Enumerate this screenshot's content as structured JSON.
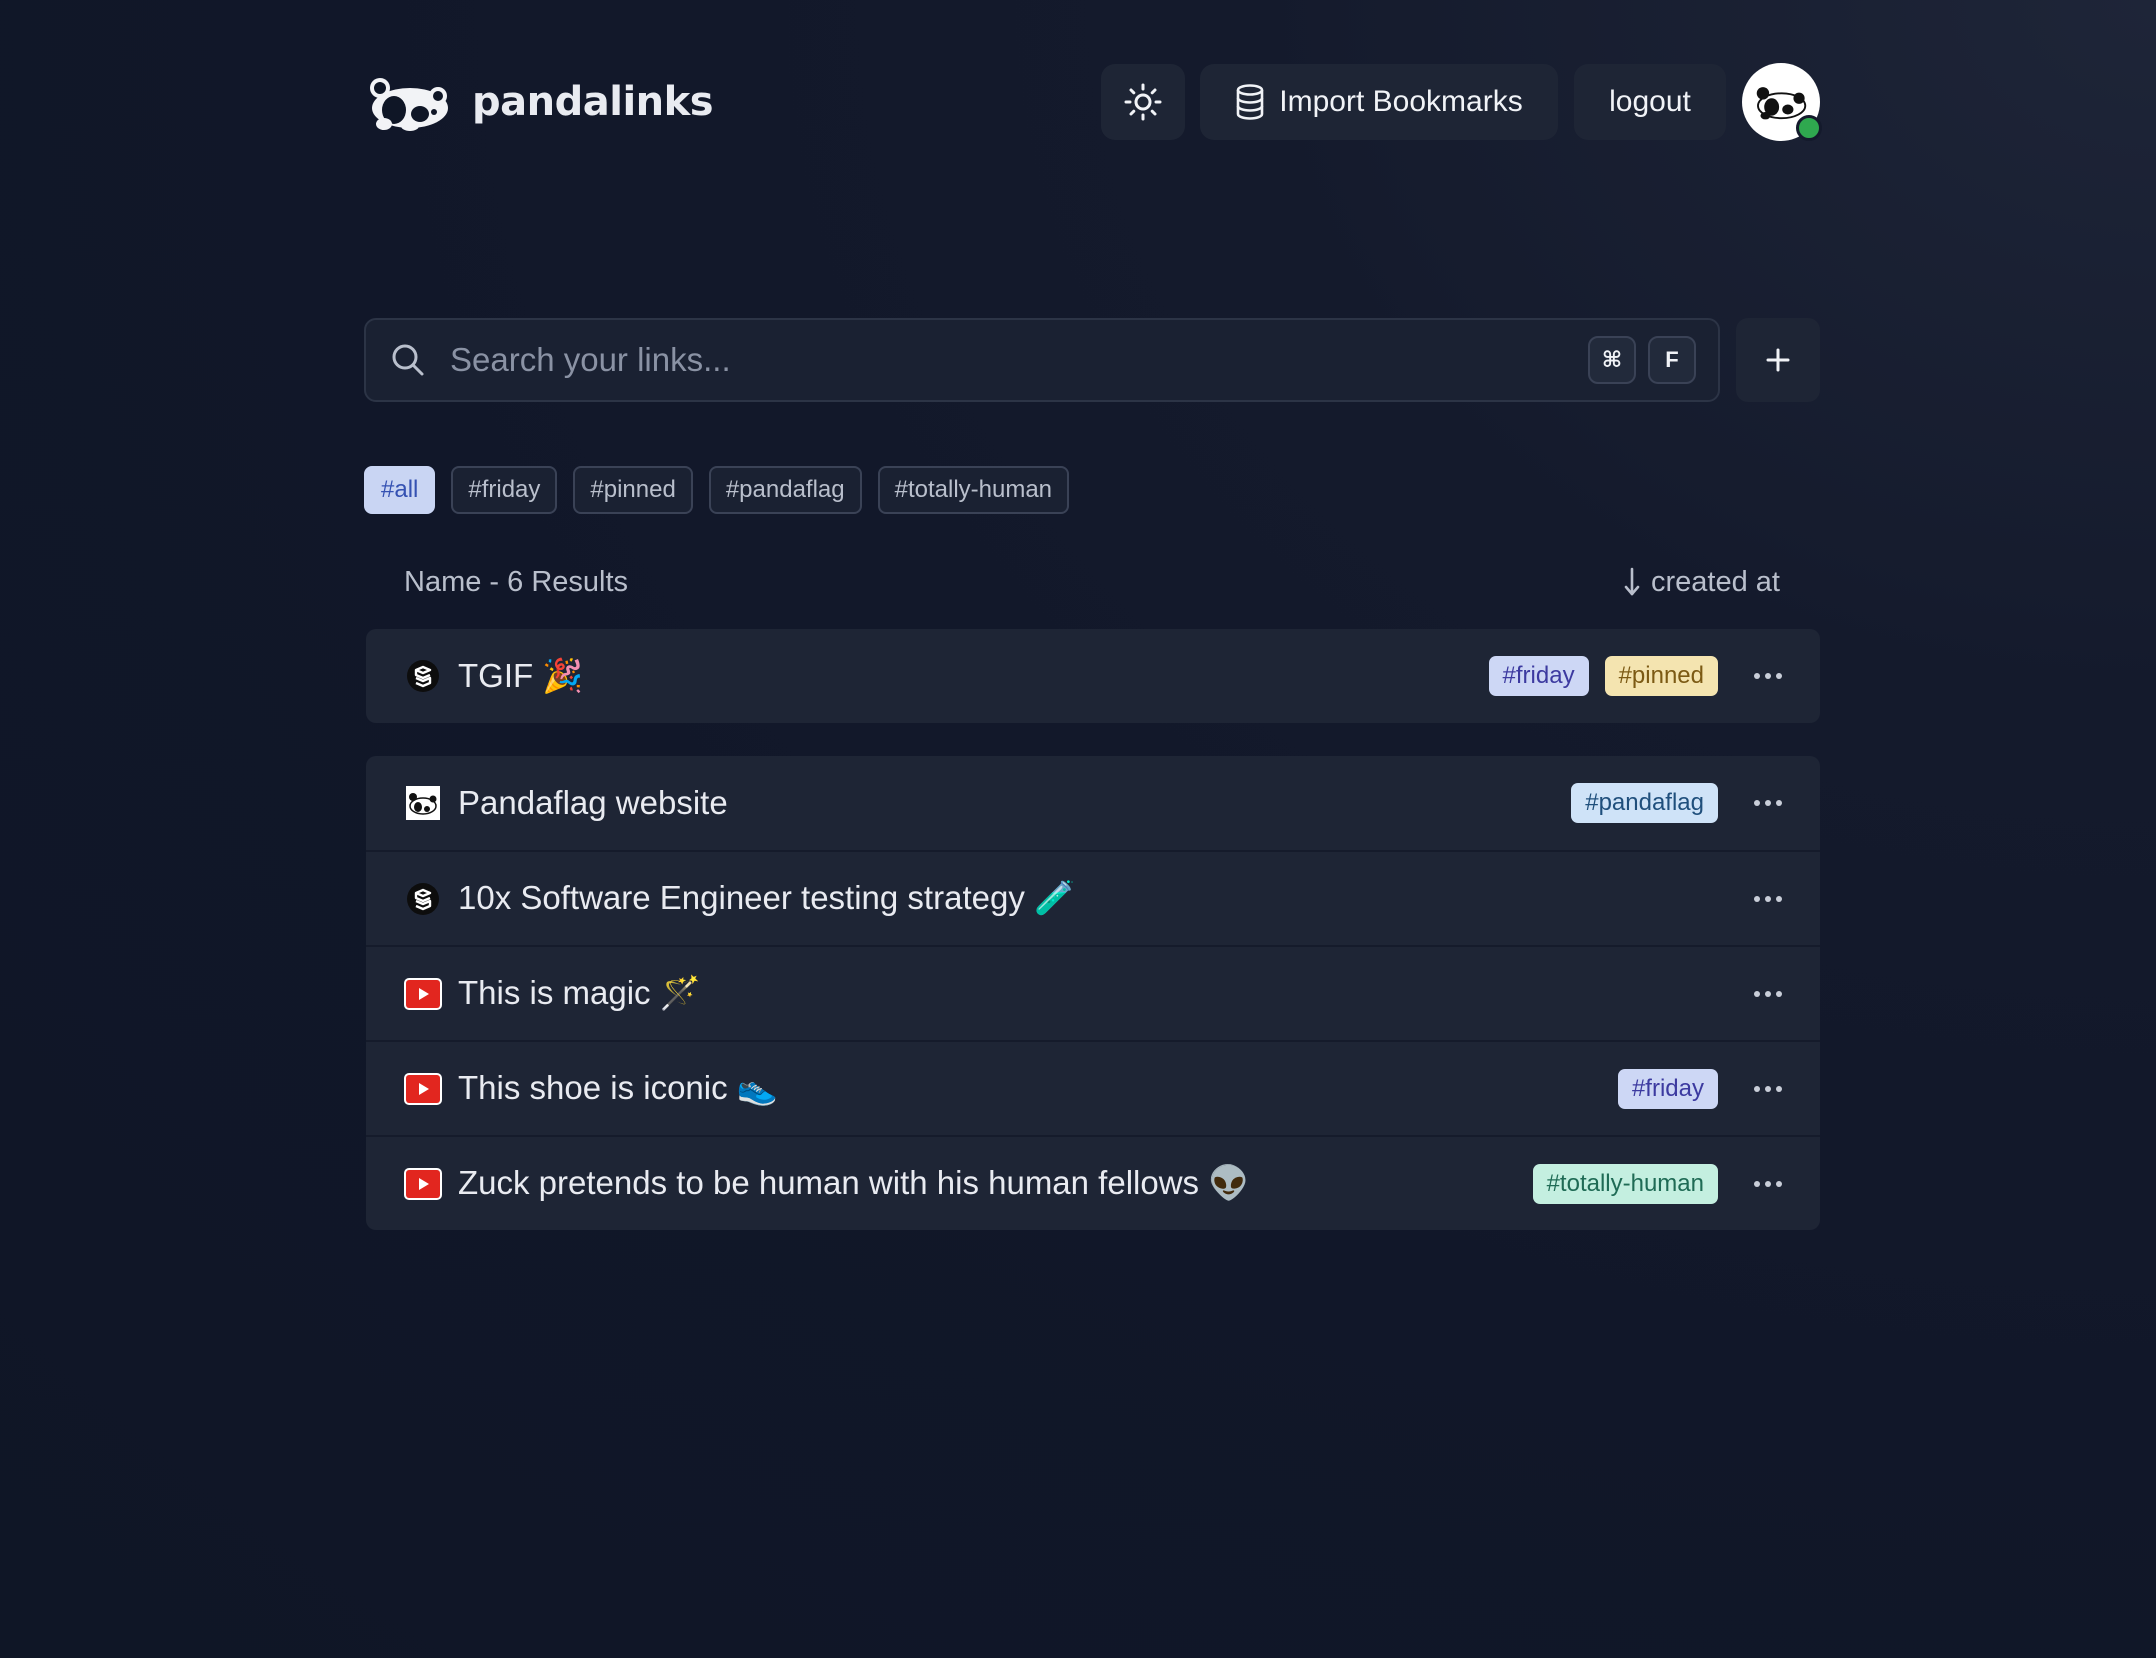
{
  "header": {
    "brand_name": "pandalinks",
    "import_label": "Import Bookmarks",
    "logout_label": "logout",
    "status_color": "#2fa84f"
  },
  "search": {
    "placeholder": "Search your links...",
    "shortcut_key_1": "⌘",
    "shortcut_key_2": "F",
    "add_icon": "plus-icon"
  },
  "filters": [
    {
      "label": "#all",
      "active": true
    },
    {
      "label": "#friday",
      "active": false
    },
    {
      "label": "#pinned",
      "active": false
    },
    {
      "label": "#pandaflag",
      "active": false
    },
    {
      "label": "#totally-human",
      "active": false
    }
  ],
  "results": {
    "summary": "Name - 6 Results",
    "sort_label": "created at",
    "sort_icon": "arrow-down-icon"
  },
  "pinned_links": [
    {
      "title": "TGIF 🎉",
      "favicon": "codesandbox-icon",
      "tags": [
        "#friday",
        "#pinned"
      ]
    }
  ],
  "links": [
    {
      "title": "Pandaflag website",
      "favicon": "panda-icon",
      "tags": [
        "#pandaflag"
      ]
    },
    {
      "title": "10x Software Engineer testing strategy 🧪",
      "favicon": "codesandbox-icon",
      "tags": []
    },
    {
      "title": "This is magic 🪄",
      "favicon": "youtube-icon",
      "tags": []
    },
    {
      "title": "This shoe is iconic 👟",
      "favicon": "youtube-icon",
      "tags": [
        "#friday"
      ]
    },
    {
      "title": "Zuck pretends to be human with his human fellows 👽",
      "favicon": "youtube-icon",
      "tags": [
        "#totally-human"
      ]
    }
  ],
  "colors": {
    "background": "#111729",
    "card": "#1e2535",
    "active_tag": "#c9d5f3",
    "youtube_red": "#e2261f"
  }
}
